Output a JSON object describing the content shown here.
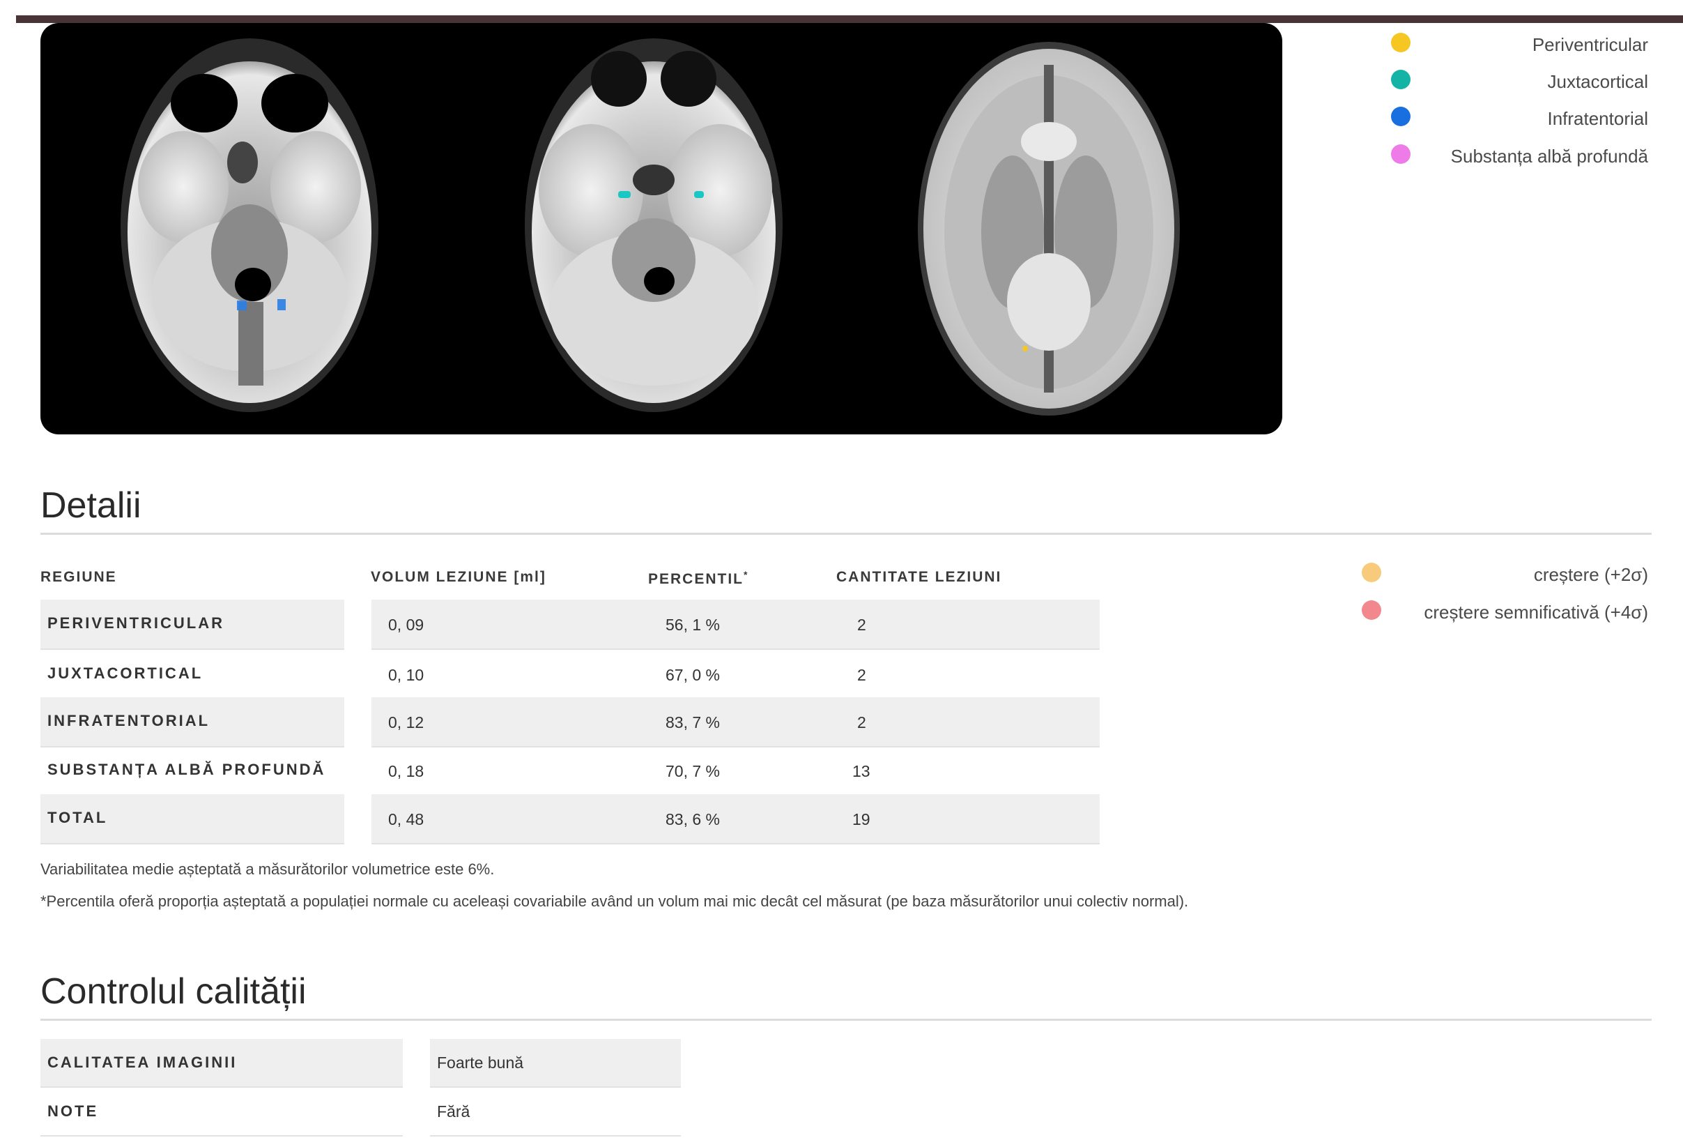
{
  "colors": {
    "topbar": "#4a3336",
    "periventricular": "#f6c623",
    "juxtacortical": "#13b3a6",
    "infratentorial": "#1a6fe0",
    "deep_white_matter": "#ee7be8",
    "increase": "#f8cb7c",
    "significant_increase": "#f2878e"
  },
  "legend": [
    {
      "label": "Periventricular",
      "color_key": "periventricular",
      "icon": "yellow-dot-icon"
    },
    {
      "label": "Juxtacortical",
      "color_key": "juxtacortical",
      "icon": "teal-dot-icon"
    },
    {
      "label": "Infratentorial",
      "color_key": "infratentorial",
      "icon": "blue-dot-icon"
    },
    {
      "label": "Substanța albă profundă",
      "color_key": "deep_white_matter",
      "icon": "pink-dot-icon"
    }
  ],
  "deviation_legend": [
    {
      "label": "creștere (+2σ)",
      "color_key": "increase"
    },
    {
      "label": "creștere semnificativă (+4σ)",
      "color_key": "significant_increase"
    }
  ],
  "details": {
    "title": "Detalii",
    "headers": {
      "region": "REGIUNE",
      "volume": "VOLUM LEZIUNE [ml]",
      "percentile": "PERCENTIL",
      "percentile_mark": "*",
      "count": "CANTITATE LEZIUNI"
    },
    "rows": [
      {
        "region": "PERIVENTRICULAR",
        "volume": "0, 09",
        "percentile": "56, 1 %",
        "count": "2"
      },
      {
        "region": "JUXTACORTICAL",
        "volume": "0, 10",
        "percentile": "67, 0 %",
        "count": "2"
      },
      {
        "region": "INFRATENTORIAL",
        "volume": "0, 12",
        "percentile": "83, 7 %",
        "count": "2"
      },
      {
        "region": "SUBSTANȚA ALBĂ PROFUNDĂ",
        "volume": "0, 18",
        "percentile": "70, 7 %",
        "count": "13"
      },
      {
        "region": "TOTAL",
        "volume": "0, 48",
        "percentile": "83, 6 %",
        "count": "19"
      }
    ],
    "note_variability": "Variabilitatea medie așteptată a măsurătorilor volumetrice este 6%.",
    "note_percentile": "*Percentila oferă proporția așteptată a populației normale cu aceleași covariabile având un volum mai mic decât cel măsurat (pe baza măsurătorilor unui colectiv normal)."
  },
  "quality": {
    "title": "Controlul calității",
    "rows": [
      {
        "label": "CALITATEA IMAGINII",
        "value": "Foarte bună"
      },
      {
        "label": "NOTE",
        "value": "Fără"
      }
    ]
  }
}
